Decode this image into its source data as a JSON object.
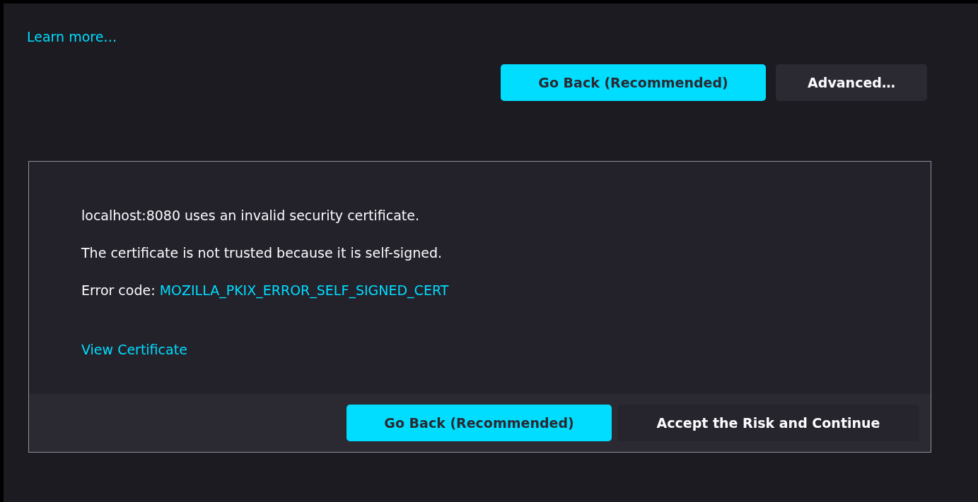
{
  "learn_more": "Learn more…",
  "top_buttons": [
    {
      "label": "Go Back (Recommended)",
      "kind": "primary"
    },
    {
      "label": "Advanced…",
      "kind": "secondary"
    }
  ],
  "advanced_panel": {
    "messages": [
      "localhost:8080 uses an invalid security certificate.",
      "The certificate is not trusted because it is self-signed."
    ],
    "error_code": {
      "label": "Error code:",
      "code": "MOZILLA_PKIX_ERROR_SELF_SIGNED_CERT"
    },
    "view_certificate": "View Certificate",
    "buttons": [
      {
        "label": "Go Back (Recommended)",
        "kind": "primary"
      },
      {
        "label": "Accept the Risk and Continue",
        "kind": "secondary"
      }
    ]
  }
}
